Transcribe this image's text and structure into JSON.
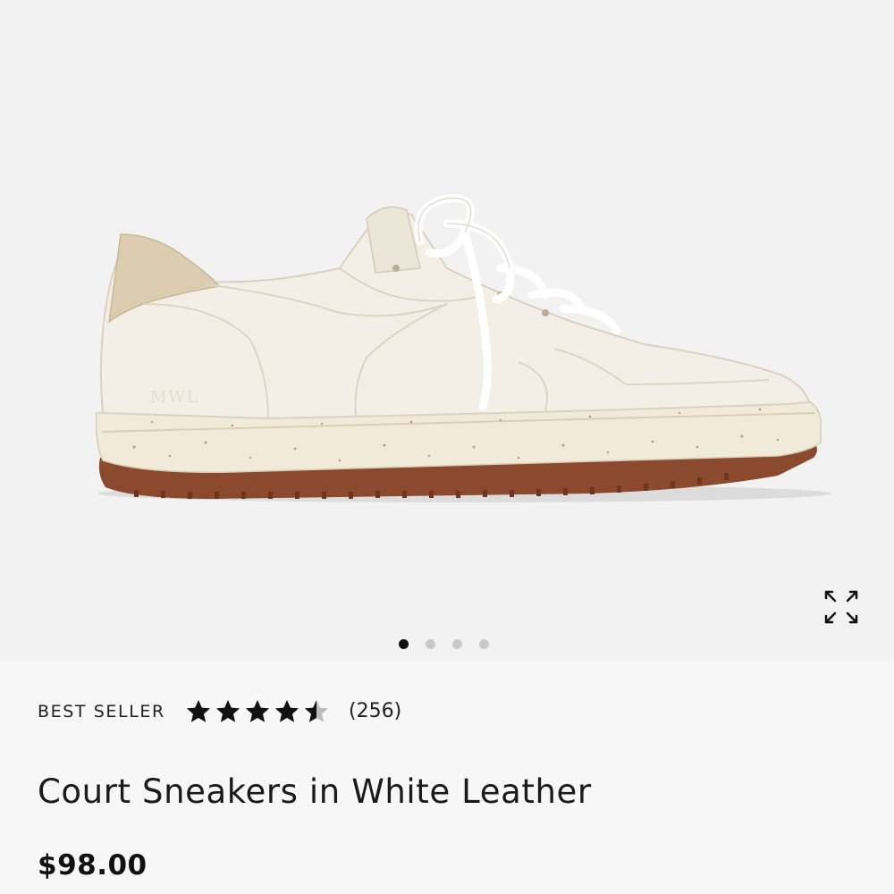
{
  "gallery": {
    "image_name": "white-leather-court-sneaker",
    "logo_text": "MWL",
    "dots": [
      {
        "active": true
      },
      {
        "active": false
      },
      {
        "active": false
      },
      {
        "active": false
      }
    ],
    "expand_icon": "expand-arrows-icon"
  },
  "product": {
    "badge": "BEST SELLER",
    "rating": 4.5,
    "rating_max": 5,
    "review_count": "(256)",
    "title": "Court Sneakers in White Leather",
    "price": "$98.00"
  },
  "colors": {
    "star_filled": "#111111",
    "star_empty": "#bdbdbd",
    "gum_sole": "#8b4a2e",
    "suede_heel": "#dccdb0",
    "leather": "#f3efe6"
  }
}
